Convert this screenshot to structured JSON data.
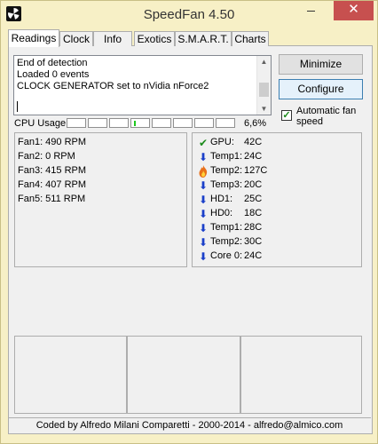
{
  "window": {
    "title": "SpeedFan 4.50",
    "minimize_glyph": "",
    "maximize_glyph": "",
    "close_glyph": "✕"
  },
  "tabs": [
    {
      "label": "Readings"
    },
    {
      "label": "Clock"
    },
    {
      "label": "Info"
    },
    {
      "label": "Exotics"
    },
    {
      "label": "S.M.A.R.T."
    },
    {
      "label": "Charts"
    }
  ],
  "log": [
    "End of detection",
    "Loaded 0 events",
    "CLOCK GENERATOR set to nVidia nForce2"
  ],
  "buttons": {
    "minimize": "Minimize",
    "configure": "Configure"
  },
  "auto_fan": {
    "label": "Automatic fan speed",
    "checked": true
  },
  "cpu_usage": {
    "label": "CPU Usage",
    "value": "6,6%",
    "meters": 8,
    "active_meter": 4
  },
  "fans": [
    "Fan1: 490 RPM",
    "Fan2: 0 RPM",
    "Fan3: 415 RPM",
    "Fan4: 407 RPM",
    "Fan5: 511 RPM"
  ],
  "temps": [
    {
      "name": "GPU:",
      "value": "42C",
      "icon": "check-icon"
    },
    {
      "name": "Temp1:",
      "value": "24C",
      "icon": "down-arrow-icon"
    },
    {
      "name": "Temp2:",
      "value": "127C",
      "icon": "flame-icon"
    },
    {
      "name": "Temp3:",
      "value": "20C",
      "icon": "down-arrow-icon"
    },
    {
      "name": "HD1:",
      "value": "25C",
      "icon": "down-arrow-icon"
    },
    {
      "name": "HD0:",
      "value": "18C",
      "icon": "down-arrow-icon"
    },
    {
      "name": "Temp1:",
      "value": "28C",
      "icon": "down-arrow-icon"
    },
    {
      "name": "Temp2:",
      "value": "30C",
      "icon": "down-arrow-icon"
    },
    {
      "name": "Core 0:",
      "value": "24C",
      "icon": "down-arrow-icon"
    }
  ],
  "footer": "Coded by Alfredo Milani Comparetti - 2000-2014 - alfredo@almico.com",
  "colors": {
    "close_button": "#c7504f",
    "check": "#1b8a1b",
    "arrow": "#1a3fc9",
    "flame": "#e8701a",
    "meter": "#1ec81e"
  }
}
